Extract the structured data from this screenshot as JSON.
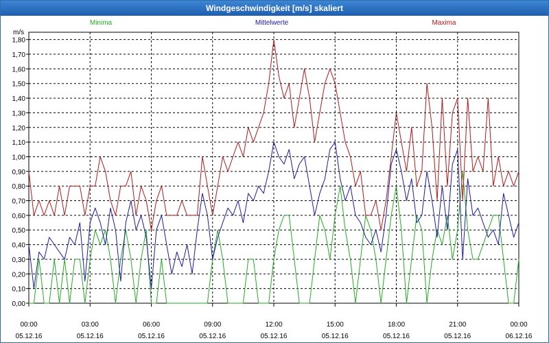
{
  "window": {
    "title": "Windgeschwindigkeit [m/s] skaliert"
  },
  "chart_data": {
    "type": "line",
    "title": "Windgeschwindigkeit [m/s] skaliert",
    "ylabel": "m/s",
    "ylim": [
      0,
      1.85
    ],
    "xlim": [
      0,
      24
    ],
    "y_ticks": [
      "0,00",
      "0,10",
      "0,20",
      "0,30",
      "0,40",
      "0,50",
      "0,60",
      "0,70",
      "0,80",
      "0,90",
      "1,00",
      "1,10",
      "1,20",
      "1,30",
      "1,40",
      "1,50",
      "1,60",
      "1,70",
      "1,80"
    ],
    "x_ticks": [
      {
        "time": "00:00",
        "date": "05.12.16"
      },
      {
        "time": "03:00",
        "date": "05.12.16"
      },
      {
        "time": "06:00",
        "date": "05.12.16"
      },
      {
        "time": "09:00",
        "date": "05.12.16"
      },
      {
        "time": "12:00",
        "date": "05.12.16"
      },
      {
        "time": "15:00",
        "date": "05.12.16"
      },
      {
        "time": "18:00",
        "date": "05.12.16"
      },
      {
        "time": "21:00",
        "date": "05.12.16"
      },
      {
        "time": "00:00",
        "date": "06.12.16"
      }
    ],
    "grid": true,
    "series": [
      {
        "name": "Minima",
        "color": "#22aa22",
        "x": [
          0,
          0.25,
          0.5,
          0.75,
          1,
          1.25,
          1.5,
          1.75,
          2,
          2.25,
          2.5,
          2.75,
          3,
          3.25,
          3.5,
          3.75,
          4,
          4.25,
          4.5,
          4.75,
          5,
          5.25,
          5.5,
          5.75,
          6,
          6.25,
          6.5,
          6.75,
          7,
          7.25,
          7.5,
          7.75,
          8,
          8.25,
          8.5,
          8.75,
          9,
          9.25,
          9.5,
          9.75,
          10,
          10.25,
          10.5,
          10.75,
          11,
          11.25,
          11.5,
          11.75,
          12,
          12.25,
          12.5,
          12.75,
          13,
          13.25,
          13.5,
          13.75,
          14,
          14.25,
          14.5,
          14.75,
          15,
          15.25,
          15.5,
          15.75,
          16,
          16.25,
          16.5,
          16.75,
          17,
          17.25,
          17.5,
          17.75,
          18,
          18.25,
          18.5,
          18.75,
          19,
          19.25,
          19.5,
          19.75,
          20,
          20.25,
          20.5,
          20.75,
          21,
          21.25,
          21.5,
          21.75,
          22,
          22.25,
          22.5,
          22.75,
          23,
          23.25,
          23.5,
          23.75,
          24
        ],
        "values": [
          0,
          0,
          0.3,
          0,
          0,
          0.3,
          0,
          0.3,
          0,
          0.3,
          0.3,
          0,
          0.3,
          0.5,
          0.4,
          0.5,
          0.3,
          0,
          0.3,
          0.5,
          0.3,
          0,
          0.3,
          0.5,
          0,
          0,
          0.3,
          0,
          0,
          0,
          0,
          0,
          0,
          0,
          0,
          0,
          0.3,
          0.5,
          0.3,
          0,
          0,
          0,
          0,
          0.3,
          0.3,
          0,
          0,
          0,
          0.3,
          0.5,
          0.6,
          0.6,
          0.3,
          0,
          0,
          0,
          0.3,
          0.6,
          0.5,
          0.3,
          0.6,
          0.8,
          0.5,
          0.3,
          0,
          0.3,
          0.6,
          0.5,
          0.3,
          0,
          0.3,
          0.6,
          0.8,
          0.5,
          0,
          0.3,
          0.6,
          0.5,
          0,
          0.3,
          0.5,
          0.4,
          0.6,
          0.3,
          0.5,
          0.9,
          0.5,
          0.3,
          0.3,
          0.4,
          0.5,
          0.6,
          0.6,
          0.3,
          0,
          0,
          0.3
        ]
      },
      {
        "name": "Mittelwerte",
        "color": "#1a1aa0",
        "x": [
          0,
          0.25,
          0.5,
          0.75,
          1,
          1.25,
          1.5,
          1.75,
          2,
          2.25,
          2.5,
          2.75,
          3,
          3.25,
          3.5,
          3.75,
          4,
          4.25,
          4.5,
          4.75,
          5,
          5.25,
          5.5,
          5.75,
          6,
          6.25,
          6.5,
          6.75,
          7,
          7.25,
          7.5,
          7.75,
          8,
          8.25,
          8.5,
          8.75,
          9,
          9.25,
          9.5,
          9.75,
          10,
          10.25,
          10.5,
          10.75,
          11,
          11.25,
          11.5,
          11.75,
          12,
          12.25,
          12.5,
          12.75,
          13,
          13.25,
          13.5,
          13.75,
          14,
          14.25,
          14.5,
          14.75,
          15,
          15.25,
          15.5,
          15.75,
          16,
          16.25,
          16.5,
          16.75,
          17,
          17.25,
          17.5,
          17.75,
          18,
          18.25,
          18.5,
          18.75,
          19,
          19.25,
          19.5,
          19.75,
          20,
          20.25,
          20.5,
          20.75,
          21,
          21.25,
          21.5,
          21.75,
          22,
          22.25,
          22.5,
          22.75,
          23,
          23.25,
          23.5,
          23.75,
          24
        ],
        "values": [
          0.4,
          0.1,
          0.35,
          0.3,
          0.45,
          0.4,
          0.35,
          0.3,
          0.45,
          0.4,
          0.55,
          0.15,
          0.55,
          0.65,
          0.55,
          0.4,
          0.65,
          0.5,
          0.15,
          0.55,
          0.7,
          0.5,
          0.6,
          0.45,
          0.1,
          0.5,
          0.6,
          0.4,
          0.2,
          0.35,
          0.25,
          0.4,
          0.2,
          0.5,
          0.75,
          0.6,
          0.3,
          0.45,
          0.55,
          0.65,
          0.6,
          0.7,
          0.55,
          0.75,
          0.7,
          0.8,
          0.75,
          0.9,
          1.1,
          1.0,
          0.95,
          1.05,
          0.85,
          0.95,
          1.0,
          0.8,
          0.6,
          0.75,
          0.85,
          1.05,
          1.1,
          0.85,
          0.7,
          0.8,
          0.6,
          0.55,
          0.45,
          0.4,
          0.5,
          0.35,
          0.6,
          0.95,
          1.05,
          0.9,
          0.7,
          0.85,
          0.55,
          0.6,
          0.9,
          0.7,
          0.45,
          0.8,
          0.5,
          0.95,
          1.05,
          0.3,
          0.85,
          0.6,
          0.65,
          0.55,
          0.45,
          0.5,
          0.4,
          0.75,
          0.6,
          0.45,
          0.55
        ]
      },
      {
        "name": "Maxima",
        "color": "#b01818",
        "x": [
          0,
          0.25,
          0.5,
          0.75,
          1,
          1.25,
          1.5,
          1.75,
          2,
          2.25,
          2.5,
          2.75,
          3,
          3.25,
          3.5,
          3.75,
          4,
          4.25,
          4.5,
          4.75,
          5,
          5.25,
          5.5,
          5.75,
          6,
          6.25,
          6.5,
          6.75,
          7,
          7.25,
          7.5,
          7.75,
          8,
          8.25,
          8.5,
          8.75,
          9,
          9.25,
          9.5,
          9.75,
          10,
          10.25,
          10.5,
          10.75,
          11,
          11.25,
          11.5,
          11.75,
          12,
          12.25,
          12.5,
          12.75,
          13,
          13.25,
          13.5,
          13.75,
          14,
          14.25,
          14.5,
          14.75,
          15,
          15.25,
          15.5,
          15.75,
          16,
          16.25,
          16.5,
          16.75,
          17,
          17.25,
          17.5,
          17.75,
          18,
          18.25,
          18.5,
          18.75,
          19,
          19.25,
          19.5,
          19.75,
          20,
          20.25,
          20.5,
          20.75,
          21,
          21.25,
          21.5,
          21.75,
          22,
          22.25,
          22.5,
          22.75,
          23,
          23.25,
          23.5,
          23.75,
          24
        ],
        "values": [
          0.9,
          0.6,
          0.7,
          0.6,
          0.7,
          0.6,
          0.8,
          0.6,
          0.8,
          0.8,
          0.8,
          0.6,
          0.8,
          0.8,
          1.0,
          0.9,
          0.7,
          0.6,
          0.8,
          0.8,
          0.9,
          0.6,
          0.8,
          0.7,
          0.5,
          0.7,
          0.8,
          0.6,
          0.6,
          0.6,
          0.7,
          0.6,
          0.6,
          0.6,
          1.0,
          0.8,
          0.6,
          0.8,
          1.0,
          0.9,
          1.0,
          1.1,
          1.0,
          1.2,
          1.1,
          1.2,
          1.3,
          1.5,
          1.8,
          1.55,
          1.4,
          1.5,
          1.2,
          1.4,
          1.6,
          1.4,
          1.1,
          1.3,
          1.5,
          1.6,
          1.5,
          1.3,
          1.1,
          1.0,
          0.8,
          0.9,
          0.6,
          0.6,
          0.7,
          0.5,
          0.7,
          1.0,
          1.3,
          1.1,
          0.9,
          1.2,
          0.8,
          0.9,
          1.5,
          1.2,
          0.7,
          1.4,
          0.8,
          1.3,
          1.4,
          0.7,
          1.4,
          0.9,
          1.0,
          0.9,
          1.4,
          0.8,
          1.0,
          0.8,
          0.9,
          0.8,
          0.9
        ]
      }
    ]
  }
}
